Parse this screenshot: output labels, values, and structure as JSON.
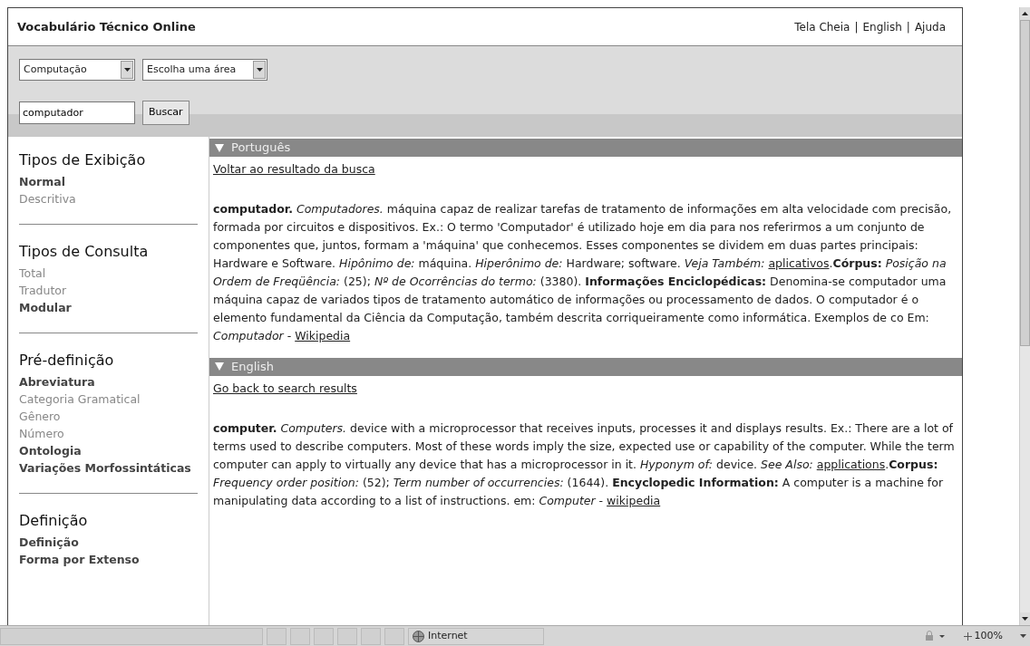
{
  "header": {
    "title": "Vocabulário Técnico Online",
    "top_links": [
      {
        "label": "Tela Cheia",
        "separator": "|"
      },
      {
        "label": "English",
        "separator": "|"
      },
      {
        "label": "Ajuda"
      }
    ]
  },
  "toolbar": {
    "selects": [
      {
        "value": "Computação"
      },
      {
        "value": "Escolha uma área"
      }
    ],
    "search": {
      "value": "computador"
    },
    "button": "Buscar"
  },
  "sidebar": {
    "sections": [
      {
        "title": "Tipos de Exibição",
        "items": [
          {
            "label": "Normal",
            "selected": true
          },
          {
            "label": "Descritiva",
            "selected": false
          }
        ]
      },
      {
        "title": "Tipos de Consulta",
        "items": [
          {
            "label": "Total",
            "selected": false
          },
          {
            "label": "Tradutor",
            "selected": false
          },
          {
            "label": "Modular",
            "selected": true
          }
        ]
      },
      {
        "title": "Pré-definição",
        "items": [
          {
            "label": "Abreviatura",
            "selected": true
          },
          {
            "label": "Categoria Gramatical",
            "selected": false
          },
          {
            "label": "Gênero",
            "selected": false
          },
          {
            "label": "Número",
            "selected": false
          },
          {
            "label": "Ontologia",
            "selected": true
          },
          {
            "label": "Variações Morfossintáticas",
            "selected": true
          }
        ]
      },
      {
        "title": "Definição",
        "items": [
          {
            "label": "Definição",
            "selected": true
          },
          {
            "label": "Forma por Extenso",
            "selected": true
          }
        ]
      }
    ]
  },
  "entries": [
    {
      "language": "Português",
      "expanded": true,
      "back_link": "Voltar ao resultado da busca",
      "segments": [
        {
          "kind": "text",
          "text": "**computador.** *Computadores.*  máquina capaz de realizar tarefas de tratamento de informações em alta velocidade com precisão, formada por circuitos e dispositivos. Ex.: O termo 'Computador' é utilizado hoje em dia para nos referirmos a um conjunto de componentes que, juntos, formam a 'máquina' que conhecemos. Esses componentes se dividem em duas partes principais: Hardware e Software. *Hipônimo de:* máquina. *Hiperônimo de:* Hardware; software. *Veja Também:* "
        },
        {
          "kind": "link",
          "text": "aplicativos"
        },
        {
          "kind": "text",
          "text": ".**Córpus:** *Posição na Ordem de Freqüência:* (25); *Nº de Ocorrências do termo:* (3380). **Informações Enciclopédicas:** Denomina-se computador uma máquina capaz de variados tipos de tratamento automático de informações ou processamento de dados. O computador é o elemento fundamental da Ciência da Computação, também descrita corriqueiramente como informática. Exemplos de co Em: *Computador* - "
        },
        {
          "kind": "link",
          "text": "Wikipedia"
        }
      ]
    },
    {
      "language": "English",
      "expanded": true,
      "back_link": "Go back to search results",
      "segments": [
        {
          "kind": "text",
          "text": "**computer.** *Computers.*  device with a microprocessor that receives inputs, processes it and displays results. Ex.: There are a lot of terms used to describe computers. Most of these words imply the size, expected use or capability of the computer. While the term computer can apply to virtually any device that has a microprocessor in it. *Hyponym of:* device. *See Also:* "
        },
        {
          "kind": "link",
          "text": "applications"
        },
        {
          "kind": "text",
          "text": ".**Corpus:** *Frequency order position:* (52); *Term number of occurrencies:* (1644). **Encyclopedic Information:** A computer is a machine for manipulating data according to a list of instructions. em: *Computer* - "
        },
        {
          "kind": "link",
          "text": "wikipedia"
        }
      ]
    }
  ],
  "status_bar": {
    "zone": "Internet",
    "zoom": "100%"
  }
}
